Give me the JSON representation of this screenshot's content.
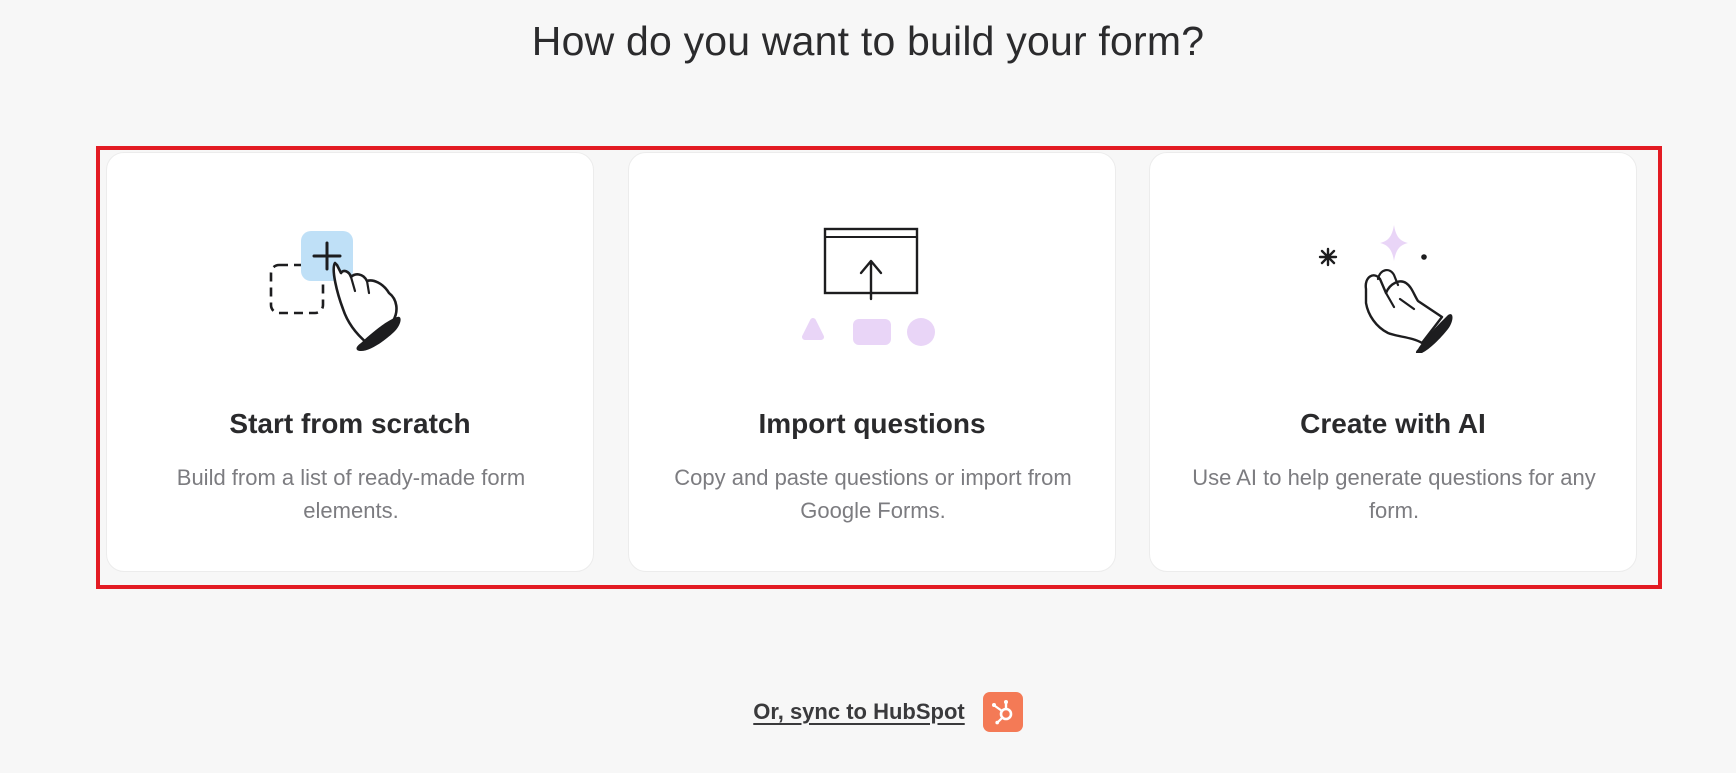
{
  "page": {
    "title": "How do you want to build your form?"
  },
  "options": [
    {
      "title": "Start from scratch",
      "description": "Build from a list of ready-made form elements.",
      "icon": "drag-add-hand-icon"
    },
    {
      "title": "Import questions",
      "description": "Copy and paste questions or import from Google Forms.",
      "icon": "import-upload-icon"
    },
    {
      "title": "Create with AI",
      "description": "Use AI to help generate questions for any form.",
      "icon": "ai-sparkle-hand-icon"
    }
  ],
  "footer": {
    "sync_label": "Or, sync to HubSpot",
    "hubspot_icon": "hubspot-icon"
  },
  "colors": {
    "background": "#f7f7f7",
    "highlight": "#e31b23",
    "hubspot": "#f47a56",
    "accent_blue": "#bfe0f7",
    "accent_purple": "#e9d5f7"
  }
}
